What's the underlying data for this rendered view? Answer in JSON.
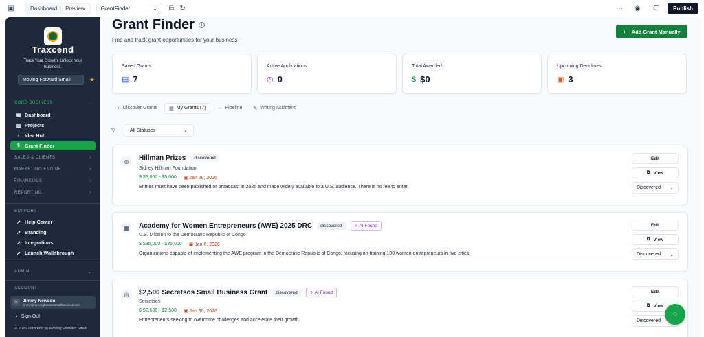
{
  "topbar": {
    "tabs": [
      "Dashboard",
      "Preview"
    ],
    "page_select": "GrantFinder",
    "publish_label": "Publish"
  },
  "sidebar": {
    "brand": "Traxcend",
    "tagline": "Track Your Growth. Unlock Your Business.",
    "business": "Moving Forward Small",
    "sections": {
      "core": "CORE BUSINESS",
      "sales": "SALES & CLIENTS",
      "marketing": "MARKETING ENGINE",
      "financials": "FINANCIALS",
      "reporting": "REPORTING",
      "support": "SUPPORT",
      "admin": "ADMIN",
      "account": "ACCOUNT"
    },
    "core_items": [
      "Dashboard",
      "Projects",
      "Idea Hub",
      "Grant Finder"
    ],
    "support_items": [
      "Help Center",
      "Branding",
      "Integrations",
      "Launch Walkthrough"
    ],
    "user_name": "Jimmy Newson",
    "user_email": "jimmy@movingforwardsmallbusiness.com",
    "sign_out": "Sign Out",
    "copyright": "© 2025 Traxcend by Moving Forward Small"
  },
  "main": {
    "title": "Grant Finder",
    "subtitle": "Find and track grant opportunities for your business",
    "add_button": "Add Grant Manually",
    "stats": [
      {
        "label": "Saved Grants",
        "value": "7",
        "color": "#2563eb"
      },
      {
        "label": "Active Applications",
        "value": "0",
        "color": "#9333ea"
      },
      {
        "label": "Total Awarded",
        "value": "$0",
        "color": "#16a34a"
      },
      {
        "label": "Upcoming Deadlines",
        "value": "3",
        "color": "#ea580c"
      }
    ],
    "tabs": [
      "Discover Grants",
      "My Grants (7)",
      "Pipeline",
      "Writing Assistant"
    ],
    "status_filter": "All Statuses",
    "grants": [
      {
        "title": "Hillman Prizes",
        "status_badge": "discovered",
        "ai_badge": "",
        "org": "Sidney Hillman Foundation",
        "amount": "$5,000 - $5,000",
        "deadline": "Jan 29, 2026",
        "description": "Entries must have been published or broadcast in 2025 and made widely available to a U.S. audience. There is no fee to enter.",
        "status_select": "Discovered"
      },
      {
        "title": "Academy for Women Entrepreneurs (AWE) 2025 DRC",
        "status_badge": "discovered",
        "ai_badge": "AI Found",
        "org": "U.S. Mission to the Democratic Republic of Congo",
        "amount": "$35,000 - $35,000",
        "deadline": "Jan 6, 2026",
        "description": "Organizations capable of implementing the AWE program in the Democratic Republic of Congo, focusing on training 100 women entrepreneurs in five cities.",
        "status_select": "Discovered"
      },
      {
        "title": "$2,500 Secretsos Small Business Grant",
        "status_badge": "discovered",
        "ai_badge": "AI Found",
        "org": "Secretsos",
        "amount": "$2,500 - $2,500",
        "deadline": "Jan 30, 2026",
        "description": "Entrepreneurs seeking to overcome challenges and accelerate their growth.",
        "status_select": "Discovered"
      }
    ],
    "edit_label": "Edit",
    "view_label": "View"
  }
}
